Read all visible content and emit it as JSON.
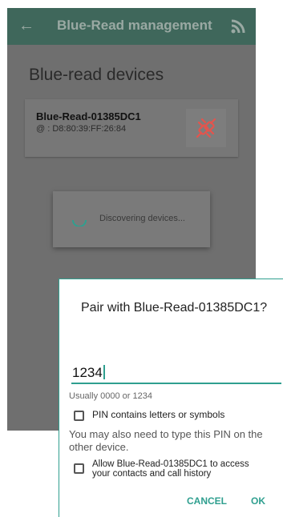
{
  "appbar": {
    "title": "Blue-Read management",
    "back_icon": "arrow-left-icon",
    "scan_icon": "rss-icon",
    "color": "#3f675b"
  },
  "main": {
    "section_title": "Blue-read devices",
    "devices": [
      {
        "name": "Blue-Read-01385DC1",
        "mac": "@ : D8:80:39:FF:26:84",
        "action_icon": "plug-disconnected-icon",
        "icon_color": "#e4544d"
      }
    ]
  },
  "progress": {
    "text": "Discovering devices...",
    "icon": "spinner-icon"
  },
  "dialog": {
    "title": "Pair with Blue-Read-01385DC1?",
    "pin_value": "1234",
    "pin_hint": "Usually 0000 or 1234",
    "checkbox_pin_letters": "PIN contains letters or symbols",
    "note": "You may also need to type this PIN on the other device.",
    "checkbox_contacts": "Allow Blue-Read-01385DC1 to access your contacts and call history",
    "cancel_label": "CANCEL",
    "ok_label": "OK",
    "accent_color": "#2f9f8f"
  }
}
